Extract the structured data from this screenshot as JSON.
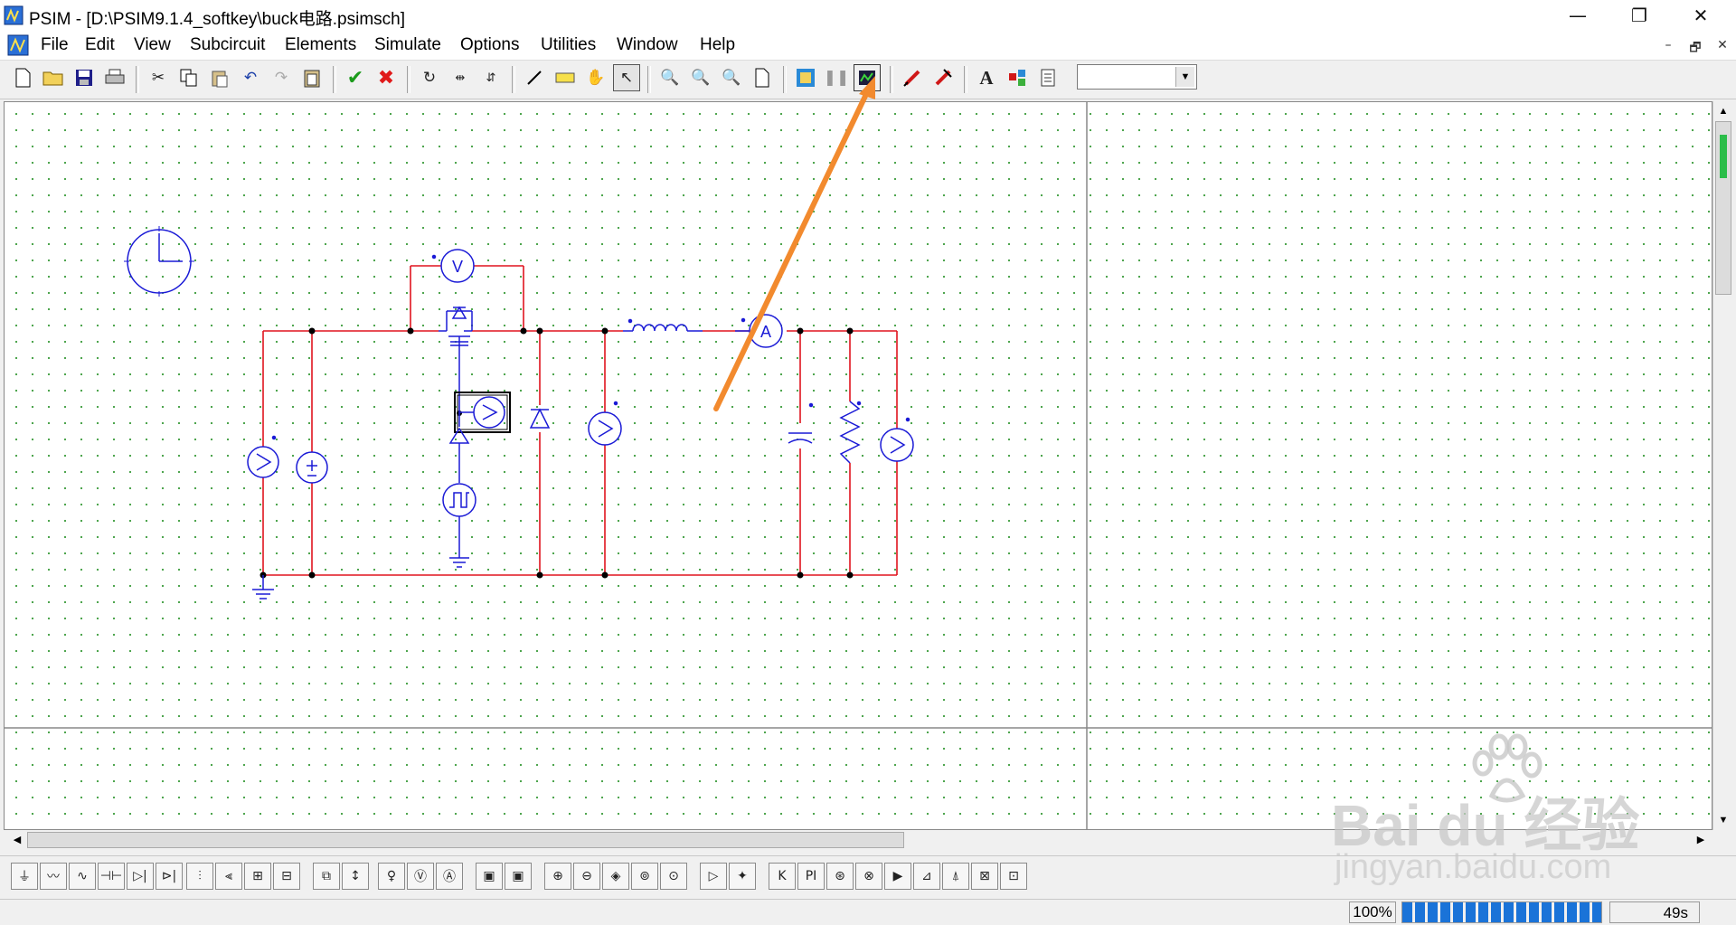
{
  "window": {
    "title": "PSIM - [D:\\PSIM9.1.4_softkey\\buck电路.psimsch]",
    "minimize": "—",
    "maximize": "❐",
    "close": "✕"
  },
  "menu": {
    "items": [
      "File",
      "Edit",
      "View",
      "Subcircuit",
      "Elements",
      "Simulate",
      "Options",
      "Utilities",
      "Window",
      "Help"
    ],
    "mdi": {
      "minimize": "–",
      "restore": "🗗",
      "close": "✕"
    }
  },
  "toolbar": {
    "combo_value": "",
    "text_tool_label": "A"
  },
  "circuit": {
    "ammeter_label": "A",
    "voltmeter_label": "V"
  },
  "status": {
    "zoom": "100%",
    "progress": 1.0,
    "time": "49s"
  },
  "watermark": {
    "brand": "Bai du 经验",
    "url": "jingyan.baidu.com"
  },
  "colors": {
    "wire": "#e0141e",
    "component": "#1a1ad6",
    "arrow": "#f28a2e",
    "grid": "#3a9b3a",
    "progress": "#1a73d8"
  }
}
